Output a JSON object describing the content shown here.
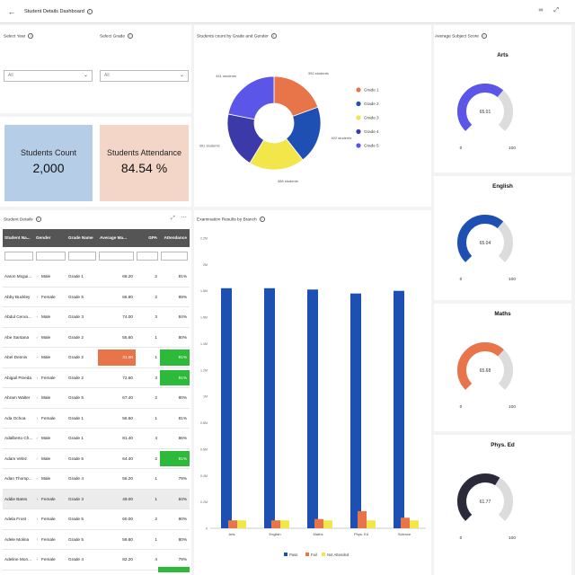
{
  "header": {
    "title": "Student Details Dashboard",
    "back_icon": "back-arrow-icon",
    "actions": [
      "binoculars-icon",
      "collapse-icon"
    ]
  },
  "filters": {
    "year": {
      "label": "Select Year",
      "value": "All"
    },
    "grade": {
      "label": "Select Grade",
      "value": "All"
    }
  },
  "kpis": {
    "count": {
      "label": "Students Count",
      "value": "2,000",
      "color": "#b5cde6"
    },
    "attendance": {
      "label": "Students Attendance",
      "value": "84.54 %",
      "color": "#f4d6c8"
    }
  },
  "table": {
    "title": "Student Details",
    "columns": [
      "Student Na...",
      "Gender",
      "Grade Name",
      "Average Ma...",
      "GPA",
      "Attendance"
    ],
    "rows": [
      [
        "Aaron Mcgui...",
        "Male",
        "Grade 1",
        "68.20",
        "2",
        "81%"
      ],
      [
        "Abby Buckley",
        "Female",
        "Grade 5",
        "66.80",
        "2",
        "89%"
      ],
      [
        "Abdul Cerva...",
        "Male",
        "Grade 3",
        "74.00",
        "3",
        "84%"
      ],
      [
        "Abe Santana",
        "Male",
        "Grade 2",
        "55.60",
        "1",
        "80%"
      ],
      [
        "Abel Dennis",
        "Male",
        "Grade 2",
        "31.00",
        "1",
        "91%"
      ],
      [
        "Abigail Pineda",
        "Female",
        "Grade 2",
        "72.60",
        "3",
        "91%"
      ],
      [
        "Abram Walter",
        "Male",
        "Grade 5",
        "67.40",
        "2",
        "80%"
      ],
      [
        "Ada Ochoa",
        "Female",
        "Grade 1",
        "56.60",
        "1",
        "81%"
      ],
      [
        "Adalberto Ch...",
        "Male",
        "Grade 1",
        "81.40",
        "4",
        "86%"
      ],
      [
        "Adam Velez",
        "Male",
        "Grade 5",
        "64.40",
        "2",
        "91%"
      ],
      [
        "Adan Thomp...",
        "Male",
        "Grade 4",
        "56.20",
        "1",
        "79%"
      ],
      [
        "Addie Bates",
        "Female",
        "Grade 3",
        "49.00",
        "1",
        "84%"
      ],
      [
        "Adela Frost",
        "Female",
        "Grade 5",
        "60.00",
        "2",
        "80%"
      ],
      [
        "Adele Molina",
        "Female",
        "Grade 5",
        "59.80",
        "1",
        "80%"
      ],
      [
        "Adeline Mon...",
        "Female",
        "Grade 4",
        "82.20",
        "4",
        "79%"
      ]
    ],
    "male_icon": "male-symbol-icon",
    "female_icon": "female-symbol-icon"
  },
  "donut": {
    "title": "Students count by Grade and Gender",
    "labels": [
      "392 students",
      "402 students",
      "388 students",
      "391 students",
      "441 students"
    ],
    "legend": [
      "Grade 1",
      "Grade 2",
      "Grade 3",
      "Grade 4",
      "Grade 5"
    ]
  },
  "bar_title": "Examination Results by Branch",
  "scores_title": "Average Subject Score",
  "gauges": [
    {
      "subject": "Arts",
      "value": "65.01",
      "min": "0",
      "max": "100",
      "fraction": 0.6501,
      "color": "#5b56e8"
    },
    {
      "subject": "English",
      "value": "65.04",
      "min": "0",
      "max": "100",
      "fraction": 0.6504,
      "color": "#1e50b4"
    },
    {
      "subject": "Maths",
      "value": "65.68",
      "min": "0",
      "max": "100",
      "fraction": 0.6568,
      "color": "#e8744a"
    },
    {
      "subject": "Phys. Ed",
      "value": "61.77",
      "min": "0",
      "max": "100",
      "fraction": 0.6177,
      "color": "#2a2a3a"
    }
  ],
  "chart_data": [
    {
      "type": "pie",
      "title": "Students count by Grade and Gender",
      "categories": [
        "Grade 1",
        "Grade 2",
        "Grade 3",
        "Grade 4",
        "Grade 5"
      ],
      "values": [
        392,
        402,
        388,
        391,
        441
      ],
      "slice_labels": [
        "392 students",
        "402 students",
        "388 students",
        "391 students",
        "441 students"
      ],
      "colors": [
        "#e8744a",
        "#1e50b4",
        "#f2e64a",
        "#3b3aa8",
        "#5b56e8"
      ],
      "legend": "right",
      "donut": true
    },
    {
      "type": "bar",
      "title": "Examination Results by Branch",
      "categories": [
        "Arts",
        "English",
        "Maths",
        "Phys. Ed",
        "Science"
      ],
      "series": [
        {
          "name": "Pass",
          "values": [
            1820000,
            1820000,
            1810000,
            1780000,
            1800000
          ],
          "color": "#1e50b4"
        },
        {
          "name": "Fail",
          "values": [
            60000,
            60000,
            70000,
            130000,
            80000
          ],
          "color": "#e8744a"
        },
        {
          "name": "Not Attended",
          "values": [
            60000,
            60000,
            60000,
            60000,
            60000
          ],
          "color": "#f2e64a"
        }
      ],
      "ylim": [
        0,
        2200000
      ],
      "yticks": [
        "0",
        "0.2M",
        "0.4M",
        "0.6M",
        "0.8M",
        "1M",
        "1.2M",
        "1.4M",
        "1.6M",
        "1.8M",
        "2M",
        "2.2M"
      ],
      "legend": "bottom",
      "grid": false
    }
  ]
}
